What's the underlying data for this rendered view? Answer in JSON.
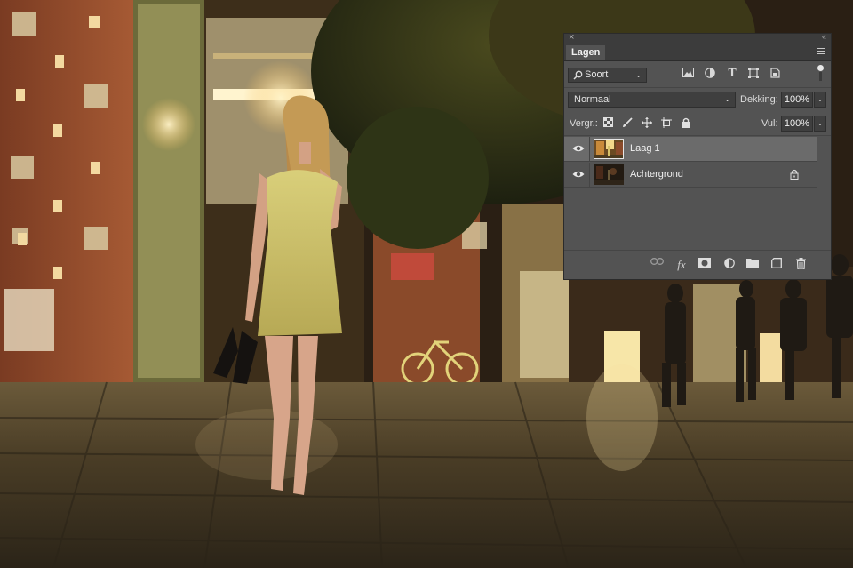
{
  "panel": {
    "tab_label": "Lagen",
    "filter": {
      "label": "Soort",
      "icon": "search-icon"
    },
    "filter_icons": [
      "image-filter-icon",
      "adjustment-filter-icon",
      "type-filter-icon",
      "shape-filter-icon",
      "smart-object-filter-icon"
    ],
    "blend_mode": "Normaal",
    "opacity_label": "Dekking:",
    "opacity_value": "100%",
    "lock_label": "Vergr.:",
    "lock_icons": [
      "lock-transparent-pixels-icon",
      "lock-image-pixels-icon",
      "lock-position-icon",
      "lock-artboard-icon",
      "lock-all-icon"
    ],
    "fill_label": "Vul:",
    "fill_value": "100%",
    "layers": [
      {
        "name": "Laag 1",
        "visible": true,
        "selected": true,
        "locked": false
      },
      {
        "name": "Achtergrond",
        "visible": true,
        "selected": false,
        "locked": true
      }
    ],
    "footer_icons": [
      "link-layers-icon",
      "fx-icon",
      "add-mask-icon",
      "adjustment-layer-icon",
      "group-folder-icon",
      "new-layer-icon",
      "trash-icon"
    ],
    "footer_fx_label": "fx"
  },
  "colors": {
    "panel_bg": "#535353",
    "panel_dark": "#3c3c3c",
    "selected_row": "#6b6b6b",
    "text": "#dcdcdc"
  }
}
